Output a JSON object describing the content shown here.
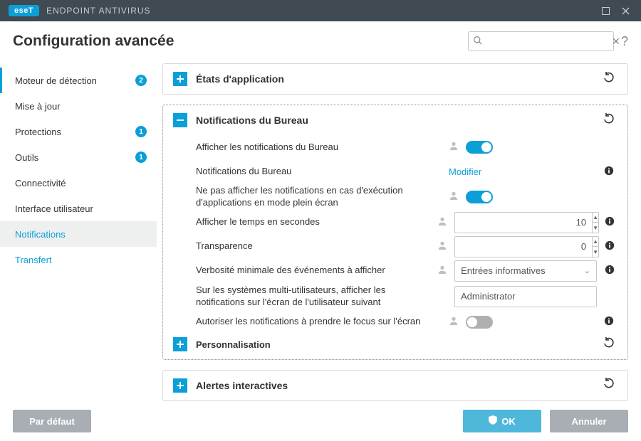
{
  "titlebar": {
    "brand_badge": "eseT",
    "brand_text": "ENDPOINT ANTIVIRUS"
  },
  "header": {
    "title": "Configuration avancée"
  },
  "search": {
    "placeholder": ""
  },
  "sidebar": [
    {
      "label": "Moteur de détection",
      "badge": "2",
      "marked": true
    },
    {
      "label": "Mise à jour"
    },
    {
      "label": "Protections",
      "badge": "1"
    },
    {
      "label": "Outils",
      "badge": "1"
    },
    {
      "label": "Connectivité"
    },
    {
      "label": "Interface utilisateur"
    },
    {
      "label": "Notifications",
      "selected": true,
      "level2": true
    },
    {
      "label": "Transfert",
      "level2": true
    }
  ],
  "panels": {
    "app_states": {
      "title": "États d'application"
    },
    "desktop_notifications": {
      "title": "Notifications du Bureau",
      "rows": {
        "show": {
          "label": "Afficher les notifications du Bureau"
        },
        "configure": {
          "label": "Notifications du Bureau",
          "link": "Modifier"
        },
        "fullscreen": {
          "label": "Ne pas afficher les notifications en cas d'exécution d'applications en mode plein écran"
        },
        "seconds": {
          "label": "Afficher le temps en secondes",
          "value": "10"
        },
        "transparency": {
          "label": "Transparence",
          "value": "0"
        },
        "verbosity": {
          "label": "Verbosité minimale des événements à afficher",
          "value": "Entrées informatives"
        },
        "multiuser": {
          "label": "Sur les systèmes multi-utilisateurs, afficher les notifications sur l'écran de l'utilisateur suivant",
          "value": "Administrator"
        },
        "focus": {
          "label": "Autoriser les notifications à prendre le focus sur l'écran"
        }
      },
      "subsection": {
        "title": "Personnalisation"
      }
    },
    "interactive_alerts": {
      "title": "Alertes interactives"
    }
  },
  "footer": {
    "default": "Par défaut",
    "ok": "OK",
    "cancel": "Annuler"
  }
}
